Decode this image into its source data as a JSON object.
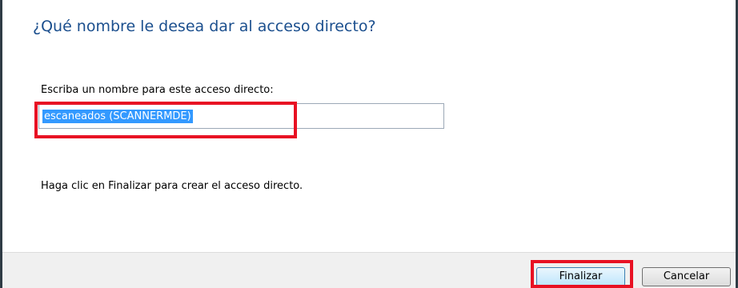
{
  "dialog": {
    "heading": "¿Qué nombre le desea dar al acceso directo?",
    "name_label": "Escriba un nombre para este acceso directo:",
    "name_value": "escaneados (SCANNERMDE)",
    "hint": "Haga clic en Finalizar para crear el acceso directo."
  },
  "buttons": {
    "finish": "Finalizar",
    "cancel": "Cancelar"
  },
  "colors": {
    "heading": "#1b4f8e",
    "selection": "#3399ff",
    "highlight": "#e81123",
    "footer": "#f0f0f0"
  }
}
